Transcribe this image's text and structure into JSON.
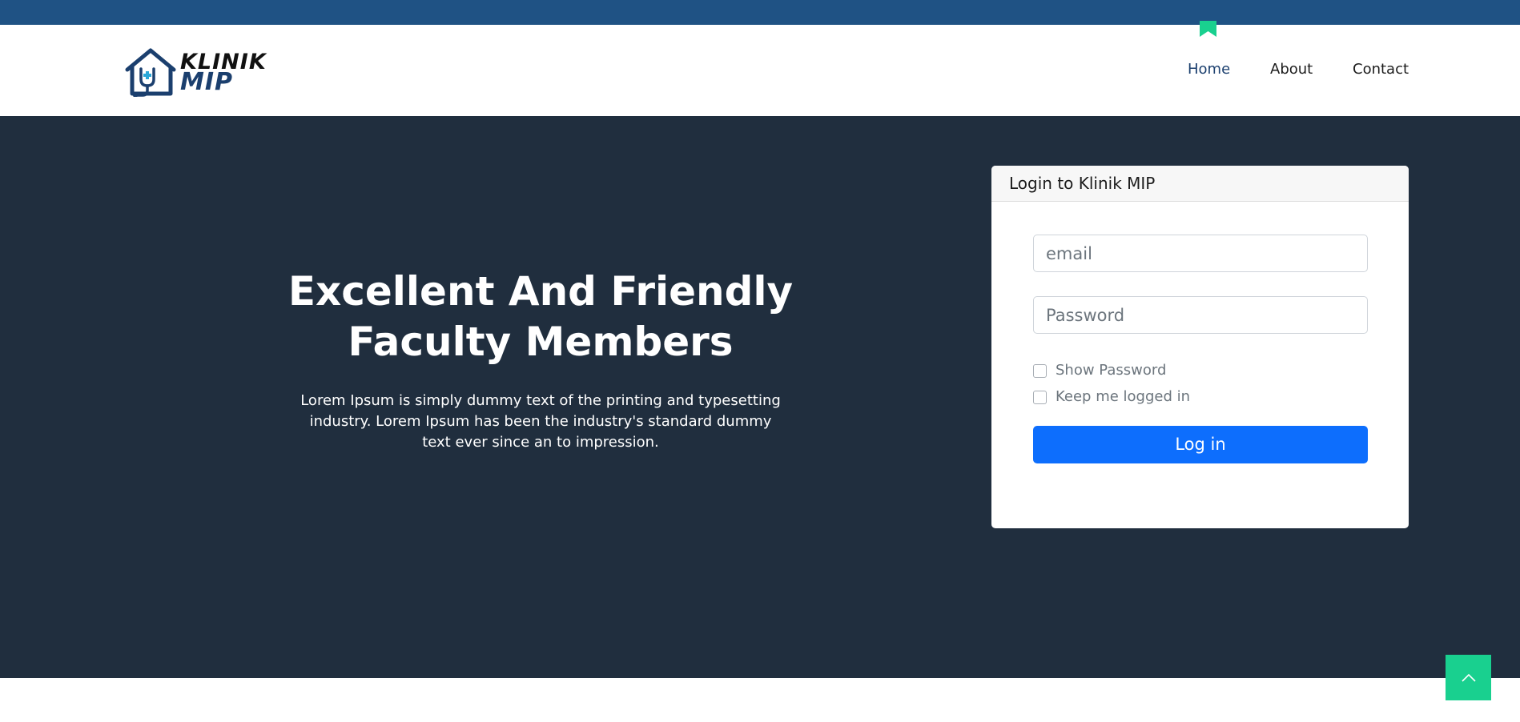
{
  "brand": {
    "line1": "KLINIK",
    "line2": "MIP",
    "colors": {
      "primary": "#1b3f6e",
      "accent": "#19d08f",
      "cross": "#2aa7d8"
    }
  },
  "nav": {
    "items": [
      {
        "label": "Home",
        "active": true
      },
      {
        "label": "About",
        "active": false
      },
      {
        "label": "Contact",
        "active": false
      }
    ]
  },
  "hero": {
    "title_line1": "Excellent And Friendly",
    "title_line2": "Faculty Members",
    "text": "Lorem Ipsum is simply dummy text of the printing and typesetting industry. Lorem Ipsum has been the industry's standard dummy text ever since an to impression."
  },
  "login": {
    "title": "Login to Klinik MIP",
    "email_placeholder": "email",
    "password_placeholder": "Password",
    "show_password_label": "Show Password",
    "remember_label": "Keep me logged in",
    "submit_label": "Log in"
  },
  "icons": {
    "scroll_top": "chevron-up-icon",
    "logo": "house-stethoscope-icon"
  },
  "colors": {
    "topbar": "#1f5284",
    "hero_bg": "#202e3e",
    "button": "#0d6efd"
  }
}
